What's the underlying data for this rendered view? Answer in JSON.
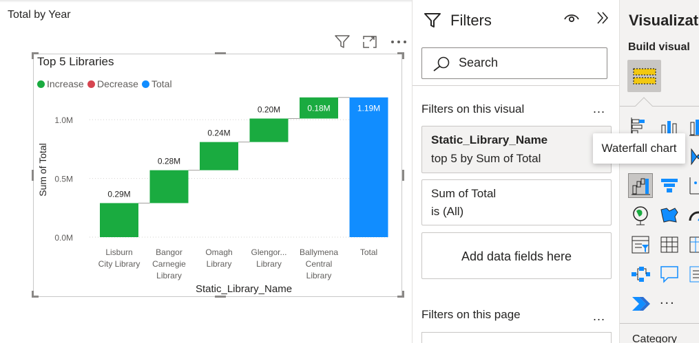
{
  "canvas": {
    "page_title": "Total by Year",
    "visual": {
      "title": "Top 5 Libraries",
      "legend": [
        {
          "label": "Increase",
          "color": "#1aab40"
        },
        {
          "label": "Decrease",
          "color": "#d64550"
        },
        {
          "label": "Total",
          "color": "#118dff"
        }
      ],
      "header_icons": [
        "filter-icon",
        "focus-mode-icon",
        "more-options-icon"
      ]
    }
  },
  "chart_data": {
    "type": "waterfall",
    "title": "Top 5 Libraries",
    "xlabel": "Static_Library_Name",
    "ylabel": "Sum of Total",
    "ylim": [
      0,
      1200000
    ],
    "y_ticks": [
      "0.0M",
      "0.5M",
      "1.0M"
    ],
    "y_tick_values": [
      0,
      500000,
      1000000
    ],
    "grid": true,
    "legend_position": "top-left",
    "categories": [
      {
        "label": [
          "Lisburn",
          "City Library"
        ],
        "value": 290000,
        "data_label": "0.29M",
        "kind": "Increase"
      },
      {
        "label": [
          "Bangor",
          "Carnegie",
          "Library"
        ],
        "value": 280000,
        "data_label": "0.28M",
        "kind": "Increase"
      },
      {
        "label": [
          "Omagh",
          "Library"
        ],
        "value": 240000,
        "data_label": "0.24M",
        "kind": "Increase"
      },
      {
        "label": [
          "Glengor...",
          "Library"
        ],
        "value": 200000,
        "data_label": "0.20M",
        "kind": "Increase"
      },
      {
        "label": [
          "Ballymena",
          "Central",
          "Library"
        ],
        "value": 180000,
        "data_label": "0.18M",
        "kind": "Increase"
      },
      {
        "label": [
          "Total"
        ],
        "value": 1190000,
        "data_label": "1.19M",
        "kind": "Total"
      }
    ],
    "colors": {
      "Increase": "#1aab40",
      "Decrease": "#d64550",
      "Total": "#118dff"
    }
  },
  "filters_pane": {
    "title": "Filters",
    "search_placeholder": "Search",
    "on_this_visual": "Filters on this visual",
    "more": "...",
    "cards": [
      {
        "name": "Static_Library_Name",
        "desc": "top 5 by Sum of Total"
      },
      {
        "name": "Sum of Total",
        "desc": "is (All)"
      }
    ],
    "add_fields": "Add data fields here",
    "on_this_page": "Filters on this page"
  },
  "viz_pane": {
    "title": "Visualizat",
    "build_visual": "Build visual",
    "more": "...",
    "category": "Category",
    "tooltip": "Waterfall chart",
    "accent": "#118dff",
    "icons": [
      "stacked-bar-chart-icon",
      "stacked-column-chart-icon",
      "clustered-bar-chart-icon",
      "line-chart-icon",
      "area-chart-icon",
      "ribbon-chart-icon",
      "waterfall-chart-icon",
      "funnel-chart-icon",
      "scatter-chart-icon",
      "globe-map-icon",
      "filled-map-icon",
      "gauge-icon",
      "slicer-icon",
      "table-icon",
      "matrix-icon",
      "decomposition-tree-icon",
      "qna-icon",
      "key-influencers-icon",
      "power-automate-icon"
    ]
  }
}
